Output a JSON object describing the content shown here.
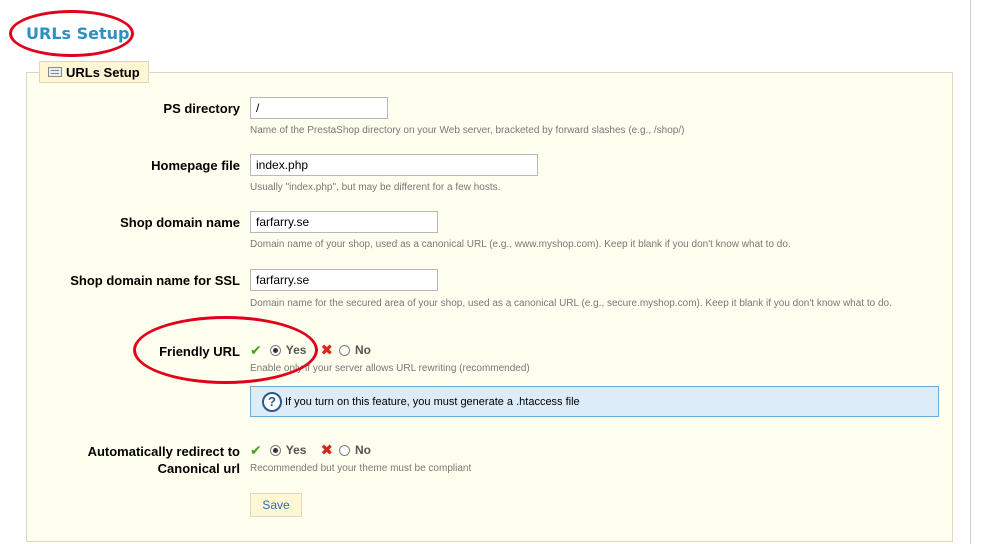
{
  "page": {
    "title": "URLs Setup"
  },
  "panel": {
    "legend": "URLs Setup",
    "legend_icon": "keyboard-icon"
  },
  "fields": {
    "ps_directory": {
      "label": "PS directory",
      "value": "/",
      "hint": "Name of the PrestaShop directory on your Web server, bracketed by forward slashes (e.g., /shop/)"
    },
    "homepage_file": {
      "label": "Homepage file",
      "value": "index.php",
      "hint": "Usually \"index.php\", but may be different for a few hosts."
    },
    "shop_domain": {
      "label": "Shop domain name",
      "value": "farfarry.se",
      "hint": "Domain name of your shop, used as a canonical URL (e.g., www.myshop.com). Keep it blank if you don't know what to do."
    },
    "shop_domain_ssl": {
      "label": "Shop domain name for SSL",
      "value": "farfarry.se",
      "hint": "Domain name for the secured area of your shop, used as a canonical URL (e.g., secure.myshop.com). Keep it blank if you don't know what to do."
    },
    "friendly_url": {
      "label": "Friendly URL",
      "yes": "Yes",
      "no": "No",
      "selected": "Yes",
      "hint": "Enable only if your server allows URL rewriting (recommended)"
    },
    "canonical_redirect": {
      "label_line1": "Automatically redirect to",
      "label_line2": "Canonical url",
      "yes": "Yes",
      "no": "No",
      "selected": "Yes",
      "hint": "Recommended but your theme must be compliant"
    }
  },
  "info": {
    "text": "If you turn on this feature, you must",
    "link": "generate a .htaccess file",
    "icon": "help-icon"
  },
  "save_label": "Save",
  "colors": {
    "title": "#2d8fc2",
    "highlight_oval": "#e2001a",
    "panel_bg": "#fffff0",
    "info_bg": "#dcecf8"
  }
}
